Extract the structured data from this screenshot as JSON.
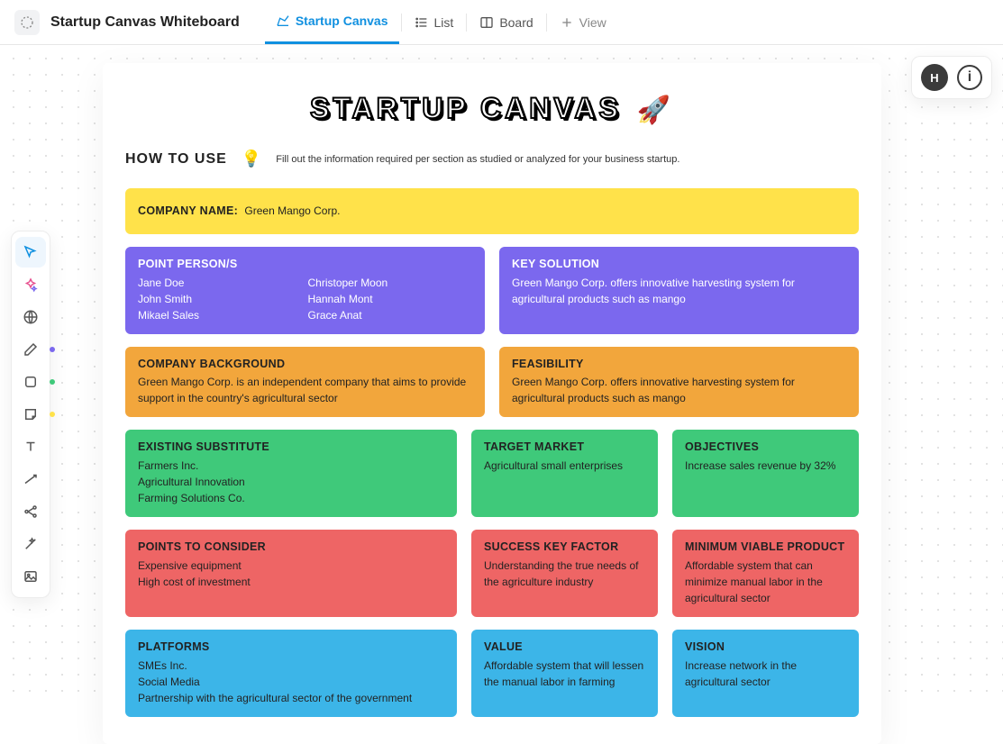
{
  "header": {
    "doc_title": "Startup Canvas Whiteboard",
    "tabs": [
      {
        "label": "Startup Canvas"
      },
      {
        "label": "List"
      },
      {
        "label": "Board"
      },
      {
        "label": "View"
      }
    ]
  },
  "topright": {
    "avatar_initial": "H"
  },
  "canvas": {
    "title": "STARTUP CANVAS",
    "howto_title": "HOW TO USE",
    "howto_text": "Fill out the information required per section as studied or analyzed for your business startup.",
    "company": {
      "label": "COMPANY NAME:",
      "value": "Green Mango Corp."
    },
    "point_persons": {
      "title": "POINT PERSON/S",
      "rows": [
        [
          "Jane Doe",
          "Christoper Moon"
        ],
        [
          "John Smith",
          "Hannah Mont"
        ],
        [
          "Mikael Sales",
          "Grace Anat"
        ]
      ]
    },
    "key_solution": {
      "title": "KEY SOLUTION",
      "body": "Green Mango Corp. offers innovative harvesting system for agricultural products such as mango"
    },
    "company_background": {
      "title": "COMPANY BACKGROUND",
      "body": "Green Mango Corp. is an independent company that aims to provide support in the country's agricultural sector"
    },
    "feasibility": {
      "title": "FEASIBILITY",
      "body": "Green Mango Corp. offers innovative harvesting system for agricultural products such as mango"
    },
    "existing_substitute": {
      "title": "EXISTING SUBSTITUTE",
      "items": [
        "Farmers Inc.",
        "Agricultural Innovation",
        "Farming Solutions Co."
      ]
    },
    "target_market": {
      "title": "TARGET MARKET",
      "body": "Agricultural small enterprises"
    },
    "objectives": {
      "title": "OBJECTIVES",
      "body": "Increase sales revenue by 32%"
    },
    "points_to_consider": {
      "title": "POINTS TO CONSIDER",
      "items": [
        "Expensive equipment",
        "High cost of investment"
      ]
    },
    "success_key_factor": {
      "title": "SUCCESS KEY FACTOR",
      "body": "Understanding the true needs of the agriculture industry"
    },
    "mvp": {
      "title": "MINIMUM VIABLE PRODUCT",
      "body": "Affordable system that can minimize manual labor in the agricultural sector"
    },
    "platforms": {
      "title": "PLATFORMS",
      "items": [
        "SMEs Inc.",
        "Social Media",
        "Partnership with the agricultural sector of the government"
      ]
    },
    "value": {
      "title": "VALUE",
      "body": "Affordable system that will lessen the manual labor in farming"
    },
    "vision": {
      "title": "VISION",
      "body": "Increase network in the agricultural sector"
    }
  }
}
